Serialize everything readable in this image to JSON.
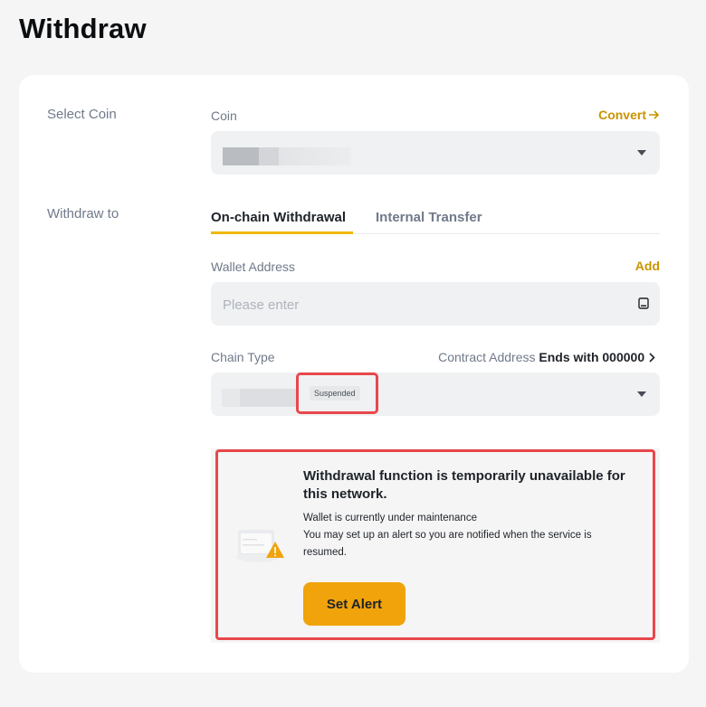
{
  "page": {
    "title": "Withdraw"
  },
  "select_coin": {
    "section_label": "Select Coin",
    "field_label": "Coin",
    "convert_label": "Convert"
  },
  "withdraw_to": {
    "section_label": "Withdraw to",
    "tabs": [
      {
        "label": "On-chain Withdrawal",
        "active": true
      },
      {
        "label": "Internal Transfer",
        "active": false
      }
    ],
    "wallet_address": {
      "label": "Wallet Address",
      "add_label": "Add",
      "placeholder": "Please enter",
      "value": ""
    },
    "chain_type": {
      "label": "Chain Type",
      "contract_prefix": "Contract Address",
      "contract_value": "Ends with 000000",
      "status_badge": "Suspended"
    }
  },
  "notice": {
    "title": "Withdrawal function is temporarily unavailable for this network.",
    "line1": "Wallet is currently under maintenance",
    "line2": "You may set up an alert so you are notified when the service is",
    "line3": "resumed.",
    "button_label": "Set Alert"
  },
  "colors": {
    "accent": "#f0a30a",
    "link": "#c99400",
    "highlight_outline": "#e8474c"
  }
}
